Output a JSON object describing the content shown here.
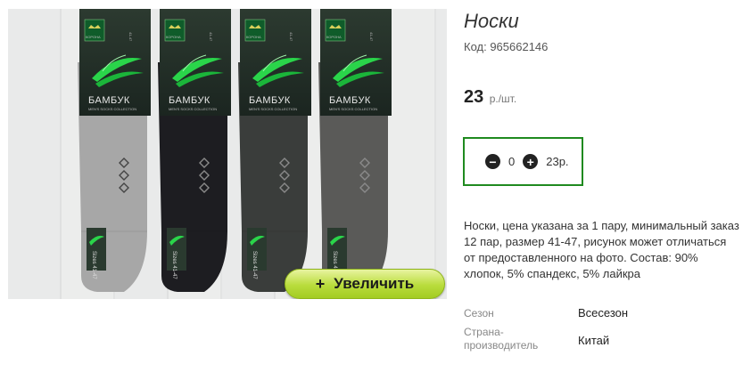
{
  "product": {
    "title": "Носки",
    "code": "Код: 965662146",
    "price_value": "23",
    "price_unit": "р./шт."
  },
  "quantity": {
    "minus_icon": "minus-circle-icon",
    "value": "0",
    "plus_icon": "plus-circle-icon",
    "total": "23р."
  },
  "photo": {
    "zoom_label": "Увеличить",
    "zoom_icon": "plus",
    "pack_brand": "БАМБУК",
    "pack_crown_label": "КОРОНА",
    "pack_subtitle": "MEN'S SOCKS COLLECTION",
    "pack_size": "41-47",
    "tag_size": "Sizes 41-47",
    "sock_colors": [
      "#a7a7a7",
      "#1d1d21",
      "#3a3d3b",
      "#5a5a58"
    ]
  },
  "description": "Носки, цена указана за 1 пару, минимальный заказ 12 пар, размер 41-47, рисунок может отличаться от предоставленного на фото. Состав: 90% хлопок, 5% спандекс, 5% лайкра",
  "properties": [
    {
      "key": "Сезон",
      "value": "Всесезон"
    },
    {
      "key": "Страна-\nпроизводитель",
      "value": "Китай"
    }
  ],
  "colors": {
    "accent_border": "#1f8a1f",
    "zoom_button": "#b9dc3c"
  }
}
